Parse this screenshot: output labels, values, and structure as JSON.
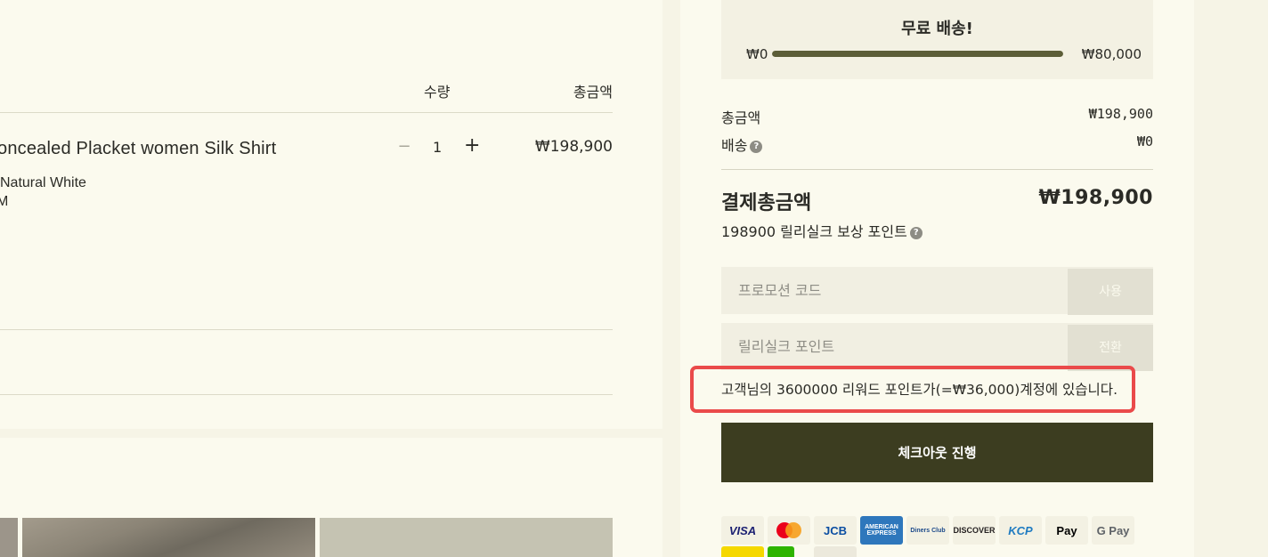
{
  "cart": {
    "header_qty": "수량",
    "header_total": "총금액",
    "item": {
      "name": "oncealed Placket women Silk Shirt",
      "color": "Natural White",
      "size": "M",
      "quantity": "1",
      "minus": "−",
      "plus": "+",
      "price": "₩198,900"
    }
  },
  "shipping": {
    "title": "무료 배송!",
    "min": "₩0",
    "max": "₩80,000",
    "progress_fraction": 1.0
  },
  "summary": {
    "subtotal_label": "총금액",
    "subtotal_value": "₩198,900",
    "shipping_label": "배송",
    "shipping_value": "₩0",
    "help_glyph": "?",
    "grand_total_label": "결제총금액",
    "grand_total_value": "₩198,900",
    "reward_text": "198900 릴리실크 보상 포인트"
  },
  "promo": {
    "placeholder": "프로모션 코드",
    "button": "사용"
  },
  "points": {
    "placeholder": "릴리실크 포인트",
    "button": "전환"
  },
  "notice": {
    "text": "고객님의 3600000 리워드 포인트가(=₩36,000)계정에 있습니다."
  },
  "checkout": {
    "label": "체크아웃 진행"
  },
  "payment_methods": [
    {
      "name": "visa",
      "label": "VISA",
      "color": "#1a1f71",
      "bg": "#f3f1e3"
    },
    {
      "name": "mastercard",
      "label": "",
      "color": "#eb001b",
      "bg": "#f3f1e3"
    },
    {
      "name": "jcb",
      "label": "JCB",
      "color": "#0b4ea2",
      "bg": "#f3f1e3"
    },
    {
      "name": "american-express",
      "label": "AMERICAN EXPRESS",
      "color": "#ffffff",
      "bg": "#2e77bc"
    },
    {
      "name": "diners-club",
      "label": "Diners Club",
      "color": "#1d4a8a",
      "bg": "#f3f1e3"
    },
    {
      "name": "discover",
      "label": "DISCOVER",
      "color": "#231f20",
      "bg": "#f3f1e3"
    },
    {
      "name": "kcp",
      "label": "KCP",
      "color": "#1f7bc1",
      "bg": "#f3f1e3"
    },
    {
      "name": "apple-pay",
      "label": "Pay",
      "color": "#000000",
      "bg": "#f3f1e3"
    },
    {
      "name": "google-pay",
      "label": "G Pay",
      "color": "#5f6368",
      "bg": "#f3f1e3"
    }
  ],
  "colors": {
    "accent": "#3c3d20",
    "progress": "#5c5e38",
    "highlight_border": "#ea4a4a",
    "panel": "#fbfaee",
    "background": "#f6f4e6"
  }
}
